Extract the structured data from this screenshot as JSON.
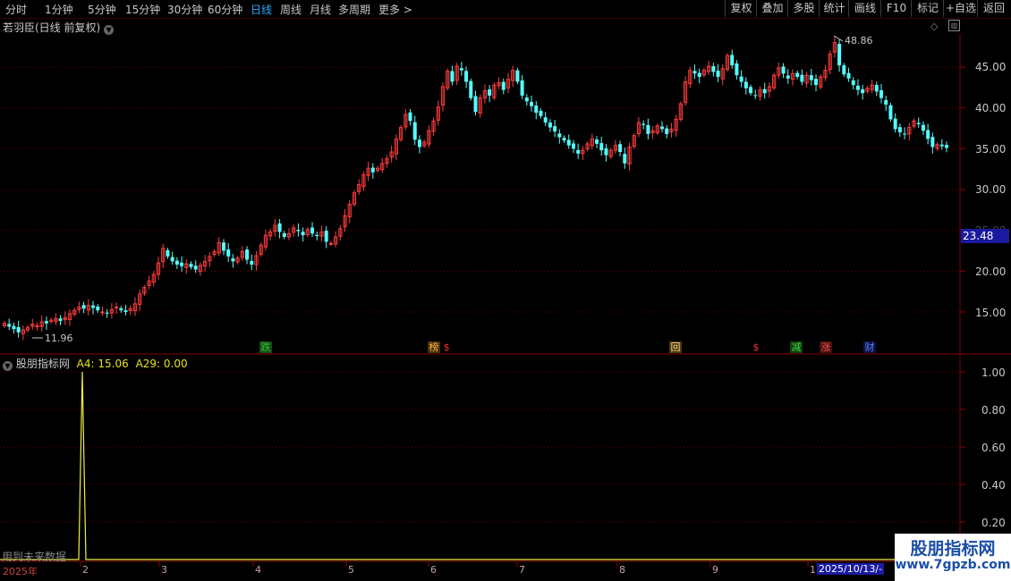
{
  "toolbar": {
    "periods": [
      "分时",
      "1分钟",
      "5分钟",
      "15分钟",
      "30分钟",
      "60分钟",
      "日线",
      "周线",
      "月线",
      "多周期",
      "更多 >"
    ],
    "active_period": "日线",
    "buttons": [
      "复权",
      "叠加",
      "多股",
      "统计",
      "画线",
      "F10",
      "标记",
      "+自选",
      "返回"
    ]
  },
  "main_chart": {
    "title": "若羽臣(日线 前复权)",
    "y_ticks": [
      "45.00",
      "40.00",
      "35.00",
      "30.00",
      "25.00",
      "20.00",
      "15.00"
    ],
    "current_price": "23.48",
    "high_label": "48.86",
    "low_label": "11.96",
    "markers": [
      {
        "text": "跌",
        "color": "#2ec82e",
        "bg": "#1a4a1a"
      },
      {
        "text": "榜",
        "color": "#ffb040",
        "bg": "#4a3010"
      },
      {
        "text": "$",
        "color": "#ff3030",
        "bg": "transparent"
      },
      {
        "text": "回",
        "color": "#ffd080",
        "bg": "#4a3a10"
      },
      {
        "text": "$",
        "color": "#ff3030",
        "bg": "transparent"
      },
      {
        "text": "减",
        "color": "#40d040",
        "bg": "#104010"
      },
      {
        "text": "涨",
        "color": "#ff5050",
        "bg": "#401010"
      },
      {
        "text": "财",
        "color": "#5080ff",
        "bg": "#101040"
      }
    ]
  },
  "indicator": {
    "name": "股朋指标网",
    "a4_label": "A4: 15.06",
    "a29_label": "A29: 0.00",
    "y_ticks": [
      "1.00",
      "0.80",
      "0.60",
      "0.40",
      "0.20"
    ],
    "note": "用到未来数据"
  },
  "x_axis": {
    "year": "2025年",
    "months": [
      "2",
      "3",
      "4",
      "5",
      "6",
      "7",
      "8",
      "9",
      "1"
    ],
    "current_date": "2025/10/13/-"
  },
  "watermark": {
    "title": "股朋指标网",
    "url": "www.7gpzb.com"
  },
  "chart_data": {
    "type": "candlestick",
    "title": "若羽臣(日线 前复权)",
    "ylim": [
      10,
      50
    ],
    "y_ticks": [
      15,
      20,
      25,
      30,
      35,
      40,
      45
    ],
    "x_ticks": [
      "2025年",
      "2",
      "3",
      "4",
      "5",
      "6",
      "7",
      "8",
      "9",
      "1"
    ],
    "close": [
      13.6,
      13.2,
      12.9,
      12.5,
      12.8,
      13.1,
      13.5,
      13.3,
      13.8,
      13.6,
      14.0,
      14.2,
      13.9,
      14.3,
      14.8,
      15.2,
      15.6,
      15.4,
      15.8,
      15.5,
      15.2,
      15.0,
      14.8,
      15.3,
      15.6,
      15.2,
      15.0,
      15.4,
      16.0,
      17.2,
      18.0,
      18.8,
      19.6,
      21.0,
      22.8,
      21.8,
      21.2,
      20.8,
      20.6,
      20.9,
      20.5,
      20.2,
      20.7,
      21.2,
      21.8,
      22.4,
      23.5,
      22.5,
      21.8,
      21.2,
      21.6,
      22.4,
      21.4,
      20.8,
      21.9,
      23.2,
      24.4,
      24.8,
      25.6,
      24.8,
      24.2,
      24.6,
      25.3,
      24.9,
      24.4,
      25.1,
      24.6,
      24.3,
      24.8,
      23.6,
      23.4,
      24.2,
      25.2,
      26.8,
      28.2,
      29.6,
      30.6,
      31.8,
      32.6,
      32.1,
      32.6,
      33.2,
      33.8,
      34.6,
      36.2,
      37.6,
      39.2,
      38.4,
      36.1,
      35.2,
      35.8,
      37.2,
      38.4,
      40.1,
      42.6,
      44.5,
      43.2,
      45.1,
      44.6,
      43.2,
      41.2,
      39.5,
      41.2,
      42.1,
      41.5,
      42.8,
      43.1,
      42.2,
      43.5,
      44.6,
      43.2,
      41.5,
      40.8,
      40.2,
      39.4,
      39.0,
      38.2,
      37.6,
      37.1,
      36.4,
      36.0,
      35.4,
      35.0,
      34.4,
      34.8,
      35.6,
      36.2,
      35.6,
      34.8,
      34.2,
      34.8,
      35.4,
      34.6,
      33.2,
      35.2,
      36.6,
      38.2,
      37.9,
      36.8,
      37.2,
      37.8,
      37.4,
      36.8,
      37.4,
      38.6,
      40.5,
      43.2,
      44.6,
      44.2,
      43.8,
      44.6,
      45.1,
      44.4,
      43.8,
      44.8,
      46.4,
      45.2,
      44.0,
      43.2,
      42.4,
      41.8,
      41.5,
      42.2,
      41.8,
      42.6,
      44.0,
      44.9,
      44.2,
      43.6,
      44.2,
      43.8,
      43.2,
      44.0,
      43.4,
      42.8,
      43.8,
      44.6,
      46.6,
      48.0,
      45.2,
      44.1,
      43.6,
      42.8,
      42.2,
      41.8,
      42.4,
      42.8,
      42.0,
      41.2,
      40.4,
      38.6,
      37.4,
      37.0,
      36.8,
      37.6,
      38.4,
      38.0,
      37.2,
      36.2,
      35.2,
      35.5,
      35.3,
      35.1
    ],
    "high_point": 48.86,
    "low_point": 11.96,
    "current_price": 23.48,
    "indicator_series": {
      "name": "股朋指标网",
      "ylim": [
        0,
        1.1
      ],
      "y_ticks": [
        1.0,
        0.8,
        0.6,
        0.4,
        0.2
      ],
      "spike_index": 29,
      "spike_value": 1.0
    }
  }
}
